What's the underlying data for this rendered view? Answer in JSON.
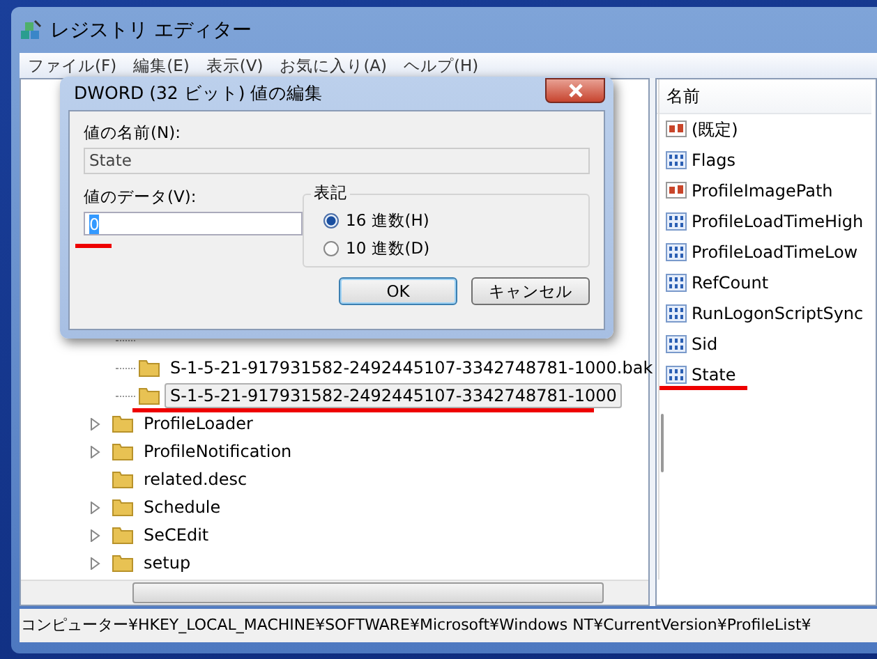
{
  "window": {
    "title": "レジストリ エディター"
  },
  "menu": [
    "ファイル(F)",
    "編集(E)",
    "表示(V)",
    "お気に入り(A)",
    "ヘルプ(H)"
  ],
  "tree": {
    "nested_items": [
      {
        "label": "S-1-5-21-917931582-2492445107-3342748781-1000.bak",
        "selected": false,
        "underlined": false
      },
      {
        "label": "S-1-5-21-917931582-2492445107-3342748781-1000",
        "selected": true,
        "underlined": true
      }
    ],
    "items": [
      {
        "label": "ProfileLoader",
        "expandable": true
      },
      {
        "label": "ProfileNotification",
        "expandable": true
      },
      {
        "label": "related.desc",
        "expandable": false
      },
      {
        "label": "Schedule",
        "expandable": true
      },
      {
        "label": "SeCEdit",
        "expandable": true
      },
      {
        "label": "setup",
        "expandable": true
      }
    ]
  },
  "values": {
    "column": "名前",
    "items": [
      {
        "name": "(既定)",
        "kind": "string",
        "underlined": false
      },
      {
        "name": "Flags",
        "kind": "dword",
        "underlined": false
      },
      {
        "name": "ProfileImagePath",
        "kind": "string",
        "underlined": false
      },
      {
        "name": "ProfileLoadTimeHigh",
        "kind": "dword",
        "underlined": false
      },
      {
        "name": "ProfileLoadTimeLow",
        "kind": "dword",
        "underlined": false
      },
      {
        "name": "RefCount",
        "kind": "dword",
        "underlined": false
      },
      {
        "name": "RunLogonScriptSync",
        "kind": "dword",
        "underlined": false
      },
      {
        "name": "Sid",
        "kind": "dword",
        "underlined": false
      },
      {
        "name": "State",
        "kind": "dword",
        "underlined": true
      }
    ]
  },
  "status_bar": "コンピューター¥HKEY_LOCAL_MACHINE¥SOFTWARE¥Microsoft¥Windows NT¥CurrentVersion¥ProfileList¥",
  "dialog": {
    "title": "DWORD (32 ビット) 値の編集",
    "name_label": "値の名前(N):",
    "name_value": "State",
    "data_label": "値のデータ(V):",
    "data_value": "0",
    "data_underlined": true,
    "base_label": "表記",
    "bases": [
      {
        "label": "16 進数(H)",
        "selected": true
      },
      {
        "label": "10 進数(D)",
        "selected": false
      }
    ],
    "buttons": [
      {
        "label": "OK",
        "default": true
      },
      {
        "label": "キャンセル",
        "default": false
      }
    ]
  }
}
